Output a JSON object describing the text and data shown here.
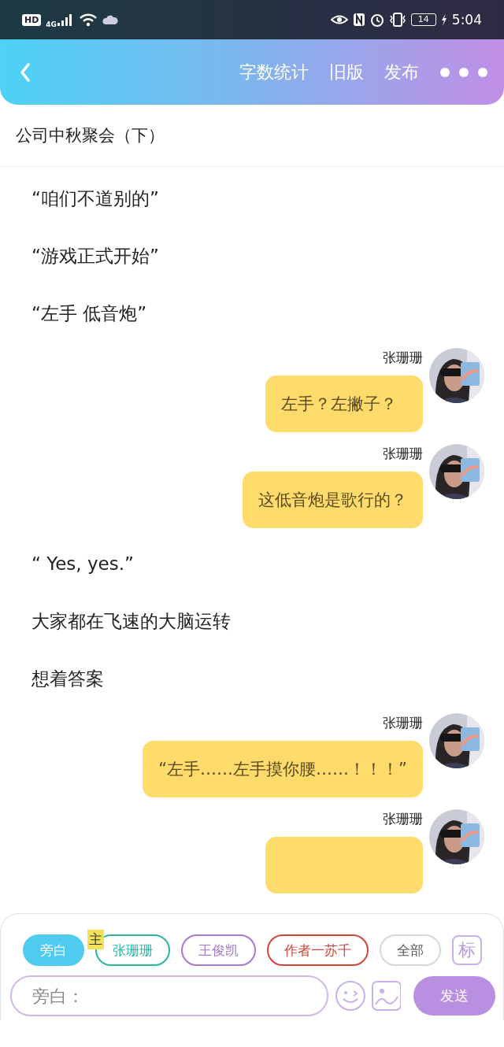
{
  "status_bar": {
    "hd": "HD",
    "network": "4G",
    "battery": "14",
    "time": "5:04"
  },
  "header": {
    "actions": [
      "字数统计",
      "旧版",
      "发布"
    ]
  },
  "title": "公司中秋聚会（下）",
  "items": [
    {
      "kind": "narration",
      "text": "“咱们不道别的”"
    },
    {
      "kind": "narration",
      "text": "“游戏正式开始”"
    },
    {
      "kind": "narration",
      "text": "“左手 低音炮”"
    },
    {
      "kind": "message",
      "speaker": "张珊珊",
      "text": "左手？左撇子？"
    },
    {
      "kind": "message",
      "speaker": "张珊珊",
      "text": "这低音炮是歌行的？"
    },
    {
      "kind": "narration",
      "text": "“ Yes, yes.”"
    },
    {
      "kind": "narration",
      "text": "大家都在飞速的大脑运转"
    },
    {
      "kind": "narration",
      "text": "想着答案"
    },
    {
      "kind": "message",
      "speaker": "张珊珊",
      "text": "“左手……左手摸你腰……！！！”"
    },
    {
      "kind": "message",
      "speaker": "张珊珊"
    }
  ],
  "roles": [
    {
      "label": "旁白",
      "color": "#4fcbef",
      "selected": true
    },
    {
      "label": "张珊珊",
      "color": "#2bb5a0",
      "selected": false,
      "badge": "主"
    },
    {
      "label": "王俊凯",
      "color": "#a77ad0",
      "selected": false
    },
    {
      "label": "作者一苏千",
      "color": "#d0463a",
      "selected": false
    },
    {
      "label": "全部",
      "color": "#d8d8d8",
      "selected": false
    }
  ],
  "mark_button": "标",
  "input": {
    "placeholder": "旁白："
  },
  "send_button": "发送"
}
